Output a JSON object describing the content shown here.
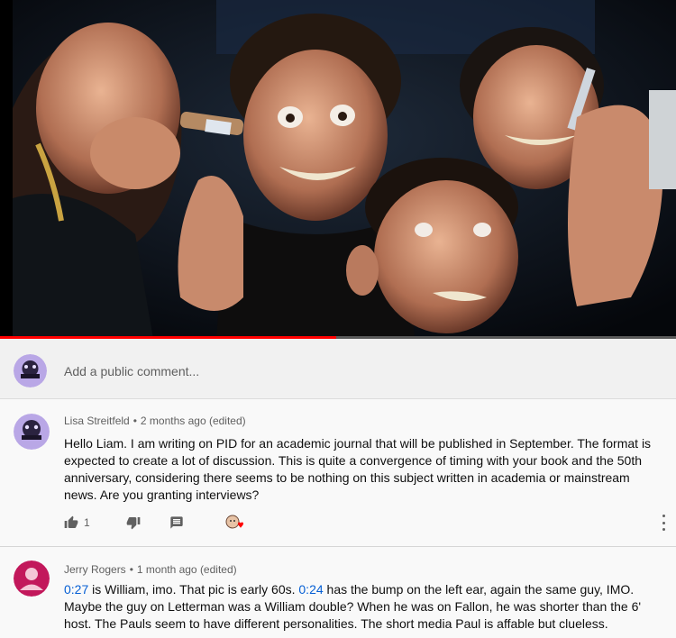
{
  "video": {
    "progress_fraction": 0.497,
    "progress_color": "#ff0000"
  },
  "add_comment": {
    "placeholder": "Add a public comment..."
  },
  "comments": [
    {
      "author": "Lisa Streitfeld",
      "time": "2 months ago (edited)",
      "text": "Hello Liam.  I am writing on PID for an academic journal that will be published in September.  The format is expected to create a lot of discussion.  This is quite a convergence of timing with your book and the 50th anniversary, considering there seems to be nothing on this subject written in academia or mainstream news.  Are you granting interviews?",
      "likes": "1",
      "icons": [
        "thumb-up-icon",
        "thumb-down-icon",
        "reply-icon",
        "creator-heart-icon",
        "more-vert-icon"
      ]
    },
    {
      "author": "Jerry Rogers",
      "time": "1 month ago (edited)",
      "ts1": "0:27",
      "text_a": " is William, imo. That pic is early 60s. ",
      "ts2": "0:24",
      "text_b": " has the bump on the left ear, again the same guy, IMO. Maybe the guy on Letterman was a William double? When he was on Fallon, he was shorter than the 6'  host. The Pauls seem to have different personalities. The short media Paul is affable but clueless.",
      "avatar_color": "#c2185b"
    }
  ],
  "colors": {
    "link": "#065fd4",
    "secondary_text": "#606060"
  }
}
